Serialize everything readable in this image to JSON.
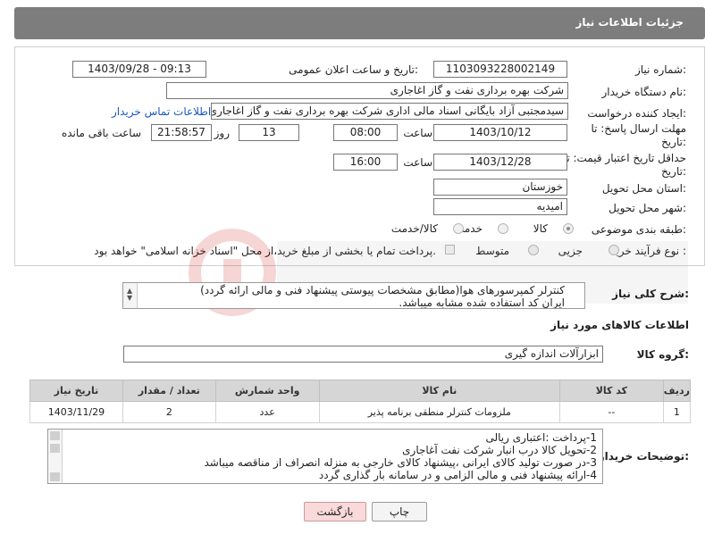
{
  "header": {
    "title": "جزئیات اطلاعات نیاز"
  },
  "fields": {
    "need_number_label": "شماره نیاز:",
    "need_number": "1103093228002149",
    "announce_label": "تاریخ و ساعت اعلان عمومی:",
    "announce_value": "1403/09/28 - 09:13",
    "buyer_label": "نام دستگاه خریدار:",
    "buyer_value": "شرکت بهره برداری نفت و گاز اغاجاری",
    "creator_label": "ایجاد کننده درخواست:",
    "creator_value": "سیدمجتبی آزاد بایگانی اسناد مالی اداری شرکت بهره برداری نفت و گاز اغاجاری",
    "contact_link": "اطلاعات تماس خریدار",
    "deadline_label_1": "مهلت ارسال پاسخ: تا",
    "deadline_label_2": "تاریخ:",
    "deadline_date": "1403/10/12",
    "time_label": "ساعت",
    "deadline_time": "08:00",
    "days_value": "13",
    "days_label": "روز و",
    "remaining_value": "21:58:57",
    "remaining_label": "ساعت باقی مانده",
    "validity_label_1": "حداقل تاریخ اعتبار قیمت: تا",
    "validity_label_2": "تاریخ:",
    "validity_date": "1403/12/28",
    "validity_time_label": "ساعت",
    "validity_time": "16:00",
    "province_label": "استان محل تحویل:",
    "province_value": "خوزستان",
    "city_label": "شهر محل تحویل:",
    "city_value": "امیدیه",
    "category_label": "طبقه بندی موضوعی:",
    "category_options": [
      "کالا",
      "خدمت",
      "کالا/خدمت"
    ],
    "process_label": "نوع فرآیند خرید :",
    "process_options": [
      "جزیی",
      "متوسط"
    ],
    "payment_note": "پرداخت تمام یا بخشی از مبلغ خرید،از محل \"اسناد خزانه اسلامی\" خواهد بود."
  },
  "description": {
    "label": "شرح کلی نیاز:",
    "line1": "کنترلر کمپرسورهای هوا(مطابق مشخصات پیوستی پیشنهاد فنی و مالی ارائه گردد)",
    "line2": "ایران کد استفاده شده مشابه میباشد."
  },
  "goods_info": {
    "title": "اطلاعات کالاهای مورد نیاز",
    "group_label": "گروه کالا:",
    "group_value": "ابزارآلات اندازه گیری"
  },
  "table": {
    "headers": [
      "ردیف",
      "کد کالا",
      "نام کالا",
      "واحد شمارش",
      "تعداد / مقدار",
      "تاریخ نیاز"
    ],
    "rows": [
      [
        "1",
        "--",
        "ملزومات کنترلر منطقی برنامه پذیر",
        "عدد",
        "2",
        "1403/11/29"
      ]
    ]
  },
  "buyer_notes": {
    "label": "توضیحات خریدار:",
    "lines": [
      "1-پرداخت :اعتباری ریالی",
      "2-تحویل کالا درب انبار شرکت نفت آغاجاری",
      "3-در صورت تولید کالای ایرانی ،پیشنهاد کالای خارجی به منزله انصراف از مناقصه میباشد",
      "4-ارائه پیشنهاد فنی و مالی الزامی و در سامانه بار گذاری گردد"
    ]
  },
  "buttons": {
    "print": "چاپ",
    "back": "بازگشت"
  },
  "colors": {
    "header_bg": "#7d7d7d",
    "link": "#1a57c4",
    "back_button": "#f9d9d9"
  }
}
